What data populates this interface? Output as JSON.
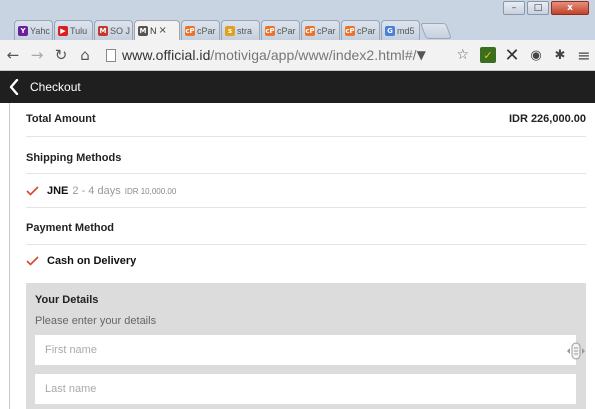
{
  "browser": {
    "tabs": [
      {
        "title": "Yahc",
        "favicon": "yahoo-icon",
        "color": "#6d1f9b",
        "glyph": "Y"
      },
      {
        "title": "Tulu",
        "favicon": "youtube-icon",
        "color": "#d82020",
        "glyph": "▶"
      },
      {
        "title": "SO J",
        "favicon": "gmail-icon",
        "color": "#c23a2b",
        "glyph": "M"
      },
      {
        "title": "N",
        "favicon": "motiviga-icon",
        "color": "#555555",
        "glyph": "M",
        "active": true
      },
      {
        "title": "cPar",
        "favicon": "cpanel-icon",
        "color": "#e8742d",
        "glyph": "cP"
      },
      {
        "title": "stra",
        "favicon": "strava-icon",
        "color": "#e0a020",
        "glyph": "s"
      },
      {
        "title": "cPar",
        "favicon": "cpanel-icon",
        "color": "#e8742d",
        "glyph": "cP"
      },
      {
        "title": "cPar",
        "favicon": "cpanel-icon",
        "color": "#e8742d",
        "glyph": "cP"
      },
      {
        "title": "cPar",
        "favicon": "cpanel-icon",
        "color": "#e8742d",
        "glyph": "cP"
      },
      {
        "title": "md5",
        "favicon": "google-icon",
        "color": "#4a7fd8",
        "glyph": "G"
      }
    ],
    "close_tab_glyph": "×",
    "url_host": "www.official.id",
    "url_path": "/motiviga/app/www/index2.html#/",
    "window_controls": {
      "minimize": "–",
      "maximize": "□",
      "close": "x"
    }
  },
  "app": {
    "title": "Checkout",
    "total": {
      "label": "Total Amount",
      "value": "IDR 226,000.00"
    },
    "shipping": {
      "label": "Shipping Methods",
      "name": "JNE",
      "days": "2 - 4 days",
      "price": "IDR 10,000.00"
    },
    "payment": {
      "label": "Payment Method",
      "option": "Cash on Delivery"
    },
    "details": {
      "title": "Your Details",
      "subtitle": "Please enter your details",
      "first_name_placeholder": "First name",
      "last_name_placeholder": "Last name"
    },
    "colors": {
      "accent": "#d9472b",
      "appbar": "#1f1f1f",
      "panel": "#dcdcdc"
    }
  }
}
